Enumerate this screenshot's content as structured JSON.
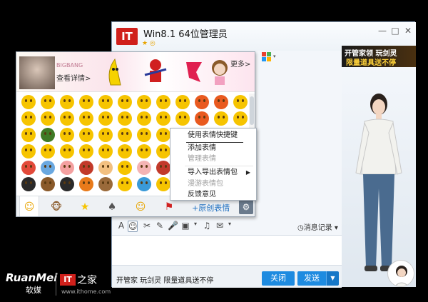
{
  "chat": {
    "app_logo": "IT",
    "title": "Win8.1 64位管理员",
    "status_icons": "★ ◎",
    "window_buttons": [
      "—",
      "□",
      "✕"
    ]
  },
  "side_ad": {
    "banner_line1": "开管家领 玩剑灵",
    "banner_line2": "限量道具送不停"
  },
  "emoji_panel": {
    "banner": {
      "name": "BIGBANG",
      "detail": "查看详情>",
      "more": "更多>"
    },
    "tabs": [
      "☺",
      "🐵",
      "★",
      "♠",
      "☺",
      "⚑"
    ],
    "add_original": "+原创表情",
    "settings_icon": "⚙",
    "grid_colors": [
      "#f6c400",
      "#f6c400",
      "#f6c400",
      "#f6c400",
      "#f6c400",
      "#f6c400",
      "#f6c400",
      "#f6c400",
      "#f6c400",
      "#e95a1f",
      "#e95a1f",
      "#f6c400",
      "#f6c400",
      "#f6c400",
      "#f6c400",
      "#f6c400",
      "#f6c400",
      "#f6c400",
      "#f6c400",
      "#f6c400",
      "#f6c400",
      "#e95a1f",
      "#f6c400",
      "#f6c400",
      "#f6c400",
      "#3f7a25",
      "#f6c400",
      "#f6c400",
      "#f6c400",
      "#f6c400",
      "#f6c400",
      "#f6c400",
      "#3a2a20",
      "#ffffff",
      "#ffffff",
      "#ffffff",
      "#f6c400",
      "#f6c400",
      "#f6c400",
      "#f6c400",
      "#f6c400",
      "#f6c400",
      "#f6c400",
      "#f6c400",
      "#f6c400",
      "#ffffff",
      "#ffffff",
      "#ffffff",
      "#e24a3a",
      "#6aa8e0",
      "#f4a0a0",
      "#c23a2a",
      "#f2c080",
      "#f6c400",
      "#f4b4b4",
      "#c23a2a",
      "#dadada",
      "#ffffff",
      "#ffffff",
      "#ffffff",
      "#2a2a2a",
      "#8a5a2a",
      "#2a2a2a",
      "#e87a1a",
      "#9a6a3a",
      "#f6c400",
      "#3a9ad8",
      "#f6c400",
      "#2a6a1a",
      "#f6c400",
      "#ffffff",
      "#ffffff"
    ]
  },
  "context_menu": {
    "items": [
      {
        "label": "使用表情快捷键",
        "disabled": false
      },
      {
        "label": "添加表情",
        "disabled": false
      },
      {
        "label": "管理表情",
        "disabled": true
      },
      {
        "label": "导入导出表情包",
        "disabled": false,
        "submenu": true
      },
      {
        "label": "漫游表情包",
        "disabled": true
      },
      {
        "label": "反馈意见",
        "disabled": false
      }
    ],
    "submenu_arrow": "▶"
  },
  "toolbar": {
    "icons": [
      "A",
      "☺",
      "✂",
      "✎",
      "🎤",
      "▣",
      "▾",
      "♫",
      "✉",
      "▾",
      "⚙"
    ],
    "history": "◷消息记录 ▾"
  },
  "footer": {
    "promo": "开管家 玩剑灵 限量道具送不停",
    "close_label": "关闭",
    "send_label": "发送",
    "send_dropdown": "▼"
  },
  "watermark": {
    "brand": "RuanMei",
    "brand_cn": "软媒",
    "it_logo": "IT",
    "it_cn": "之家",
    "url": "www.ithome.com"
  },
  "colors": {
    "accent_blue": "#1e8be0",
    "logo_red": "#d0201b",
    "app_squares": [
      "#e8402e",
      "#4caf50",
      "#2196f3",
      "#ffb300"
    ]
  }
}
